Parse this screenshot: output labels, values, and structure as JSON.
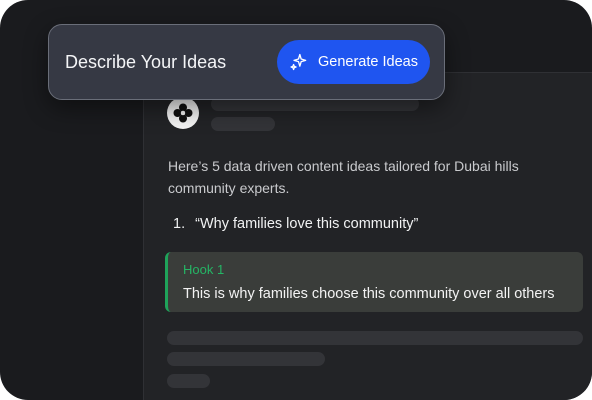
{
  "prompt_card": {
    "title": "Describe Your Ideas",
    "button_label": "Generate Ideas",
    "button_icon": "sparkles-icon",
    "accent": "#1f55f0"
  },
  "chat": {
    "avatar_icon": "logo-icon",
    "message": "Here’s 5 data driven content ideas tailored for Dubai hills community experts.",
    "list_items": [
      {
        "number": "1.",
        "text": "“Why families love this community”"
      }
    ],
    "hook": {
      "title": "Hook 1",
      "text": "This is why families choose this community over all others",
      "accent": "#1fa35a"
    }
  }
}
